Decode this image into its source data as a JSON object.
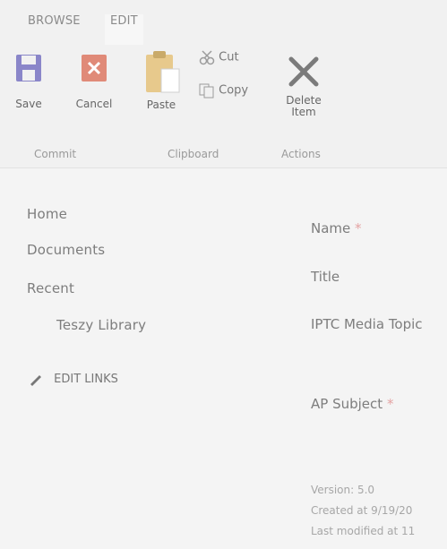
{
  "ribbon": {
    "tabs": [
      {
        "label": "BROWSE"
      },
      {
        "label": "EDIT"
      }
    ],
    "commit": {
      "save_label": "Save",
      "cancel_label": "Cancel",
      "group_label": "Commit"
    },
    "clipboard": {
      "paste_label": "Paste",
      "cut_label": "Cut",
      "copy_label": "Copy",
      "group_label": "Clipboard"
    },
    "actions": {
      "delete_label_line1": "Delete",
      "delete_label_line2": "Item",
      "group_label": "Actions"
    }
  },
  "sidebar": {
    "items": [
      {
        "label": "Home"
      },
      {
        "label": "Documents"
      },
      {
        "label": "Recent"
      },
      {
        "label": "Teszy Library"
      }
    ],
    "edit_links_label": "EDIT LINKS"
  },
  "form": {
    "fields": [
      {
        "label": "Name",
        "required_mark": "*"
      },
      {
        "label": "Title"
      },
      {
        "label": "IPTC Media Topic"
      },
      {
        "label": "AP Subject",
        "required_mark": "*"
      }
    ],
    "version": "Version: 5.0",
    "created": "Created at 9/19/20",
    "modified": "Last modified at 11"
  },
  "colors": {
    "save_icon": "#8a86c9",
    "cancel_icon": "#e08a78",
    "paste_icon": "#e7c98c",
    "required_mark": "#e4a3a3"
  }
}
